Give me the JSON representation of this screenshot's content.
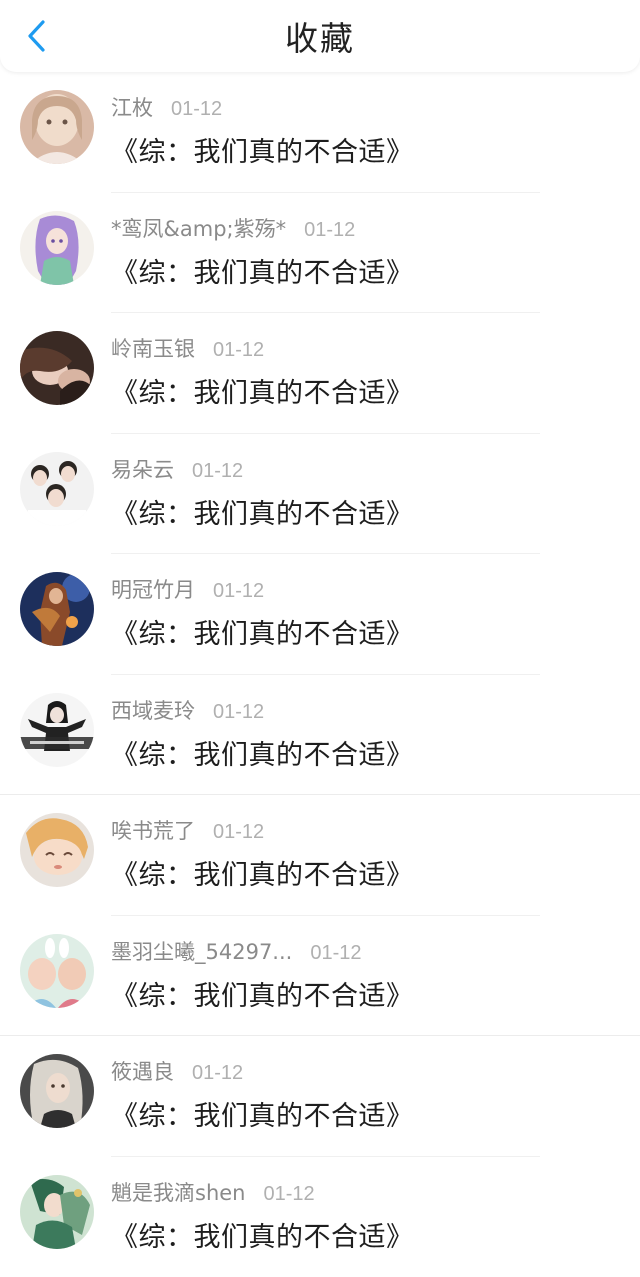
{
  "header": {
    "title": "收藏",
    "back_icon": "chevron-left-icon",
    "accent": "#1e9bf0"
  },
  "favorites": [
    {
      "user": "江枚",
      "date": "01-12",
      "book": "《综：我们真的不合适》"
    },
    {
      "user": "*鸾凤&amp;紫殇*",
      "date": "01-12",
      "book": "《综：我们真的不合适》"
    },
    {
      "user": "岭南玉银",
      "date": "01-12",
      "book": "《综：我们真的不合适》"
    },
    {
      "user": "易朵云",
      "date": "01-12",
      "book": "《综：我们真的不合适》"
    },
    {
      "user": "明冠竹月",
      "date": "01-12",
      "book": "《综：我们真的不合适》"
    },
    {
      "user": "西域麦玲",
      "date": "01-12",
      "book": "《综：我们真的不合适》"
    },
    {
      "user": "唉书荒了",
      "date": "01-12",
      "book": "《综：我们真的不合适》"
    },
    {
      "user": "墨羽尘曦_54297...",
      "date": "01-12",
      "book": "《综：我们真的不合适》"
    },
    {
      "user": "筱遇良",
      "date": "01-12",
      "book": "《综：我们真的不合适》"
    },
    {
      "user": "魈是我滴shen",
      "date": "01-12",
      "book": "《综：我们真的不合适》"
    }
  ]
}
